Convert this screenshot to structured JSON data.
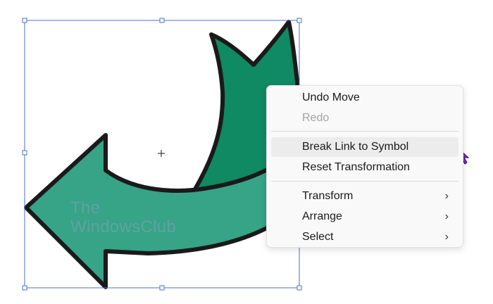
{
  "canvas": {
    "arrow_fill": "#37a387",
    "arrow_dark_fill": "#0f8a63",
    "arrow_stroke": "#1a1a1a",
    "selection_color": "#4a72c4"
  },
  "watermark": {
    "line1": "The",
    "line2": "WindowsClub"
  },
  "context_menu": {
    "items": [
      {
        "label": "Undo Move",
        "enabled": true
      },
      {
        "label": "Redo",
        "enabled": false
      },
      {
        "label": "Break Link to Symbol",
        "enabled": true,
        "hovered": true
      },
      {
        "label": "Reset Transformation",
        "enabled": true
      },
      {
        "label": "Transform",
        "enabled": true,
        "submenu": true
      },
      {
        "label": "Arrange",
        "enabled": true,
        "submenu": true
      },
      {
        "label": "Select",
        "enabled": true,
        "submenu": true
      }
    ],
    "submenu_icon": "chevron-right-icon"
  },
  "cursor": {
    "icon": "pointer-arrow-icon",
    "color": "#7a2fd4"
  }
}
